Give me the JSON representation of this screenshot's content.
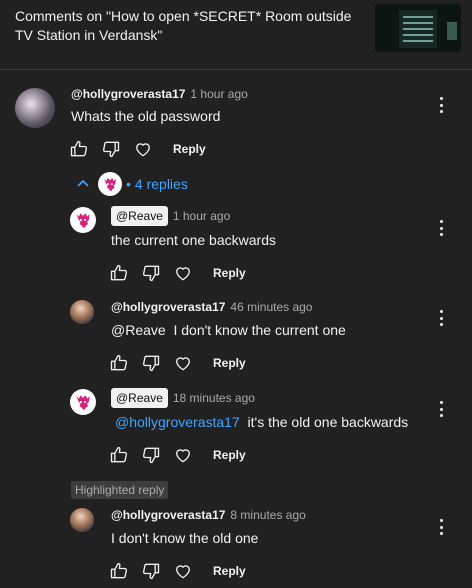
{
  "header": {
    "title": "Comments on \"How to open *SECRET* Room outside TV Station in Verdansk\"",
    "thumbnail_icon": "video-thumbnail"
  },
  "comment": {
    "author": "@hollygroverasta17",
    "time": "1 hour ago",
    "text": "Whats the old password",
    "reply_label": "Reply"
  },
  "replies_toggle": {
    "count_label": "4 replies"
  },
  "replies": [
    {
      "author": "@Reave",
      "time": "1 hour ago",
      "text": "the current one backwards",
      "reply_label": "Reply"
    },
    {
      "author": "@hollygroverasta17",
      "time": "46 minutes ago",
      "mention": "@Reave",
      "text": "I don't know the current one",
      "reply_label": "Reply"
    },
    {
      "author": "@Reave",
      "time": "18 minutes ago",
      "mention": "@hollygroverasta17",
      "text": "it's the old one backwards",
      "reply_label": "Reply"
    },
    {
      "badge": "Highlighted reply",
      "author": "@hollygroverasta17",
      "time": "8 minutes ago",
      "text": "I don't know the old one",
      "reply_label": "Reply"
    }
  ],
  "colors": {
    "background": "#212121",
    "text": "#f1f1f1",
    "secondary_text": "#aaaaaa",
    "link": "#3ea6ff",
    "reave_brand": "#d6207c"
  }
}
